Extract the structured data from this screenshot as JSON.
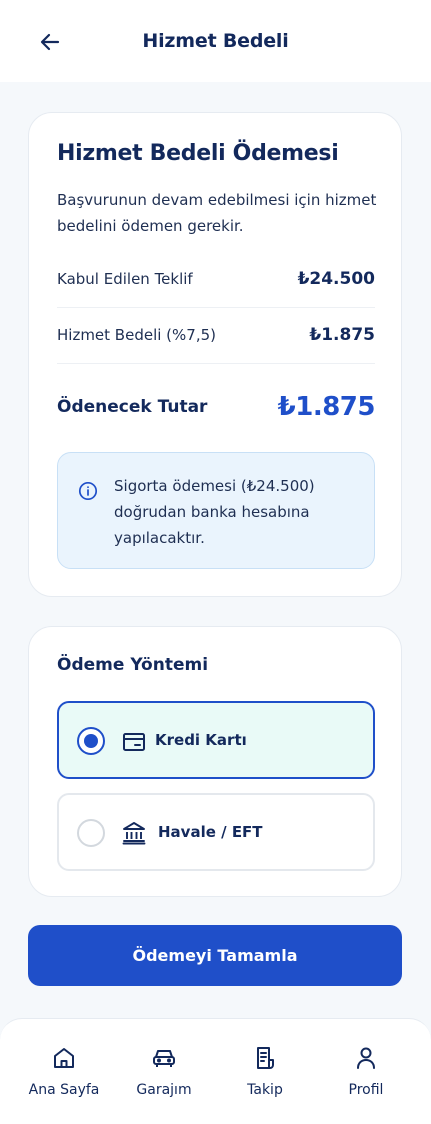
{
  "header": {
    "title": "Hizmet Bedeli",
    "back_icon": "arrow-left-icon"
  },
  "summary": {
    "title": "Hizmet Bedeli Ödemesi",
    "description": "Başvurunun devam edebilmesi için hizmet bedelini ödemen gerekir.",
    "rows": [
      {
        "label": "Kabul Edilen Teklif",
        "value": "₺24.500"
      },
      {
        "label": "Hizmet Bedeli (%7,5)",
        "value": "₺1.875"
      }
    ],
    "total": {
      "label": "Ödenecek Tutar",
      "value": "₺1.875"
    },
    "info": {
      "icon": "info-icon",
      "text": "Sigorta ödemesi (₺24.500) doğrudan banka hesabına yapılacaktır."
    }
  },
  "payment_method": {
    "title": "Ödeme Yöntemi",
    "options": [
      {
        "label": "Kredi Kartı",
        "icon": "credit-card-icon",
        "selected": true
      },
      {
        "label": "Havale / EFT",
        "icon": "bank-icon",
        "selected": false
      }
    ]
  },
  "cta": {
    "label": "Ödemeyi Tamamla"
  },
  "bottom_nav": {
    "items": [
      {
        "label": "Ana Sayfa",
        "icon": "home-icon"
      },
      {
        "label": "Garajım",
        "icon": "car-icon"
      },
      {
        "label": "Takip",
        "icon": "document-icon"
      },
      {
        "label": "Profil",
        "icon": "user-icon"
      }
    ]
  },
  "colors": {
    "primary": "#1f4fc9",
    "text_dark": "#13295c",
    "selected_bg": "#e9faf7",
    "info_bg": "#eaf4fd"
  }
}
